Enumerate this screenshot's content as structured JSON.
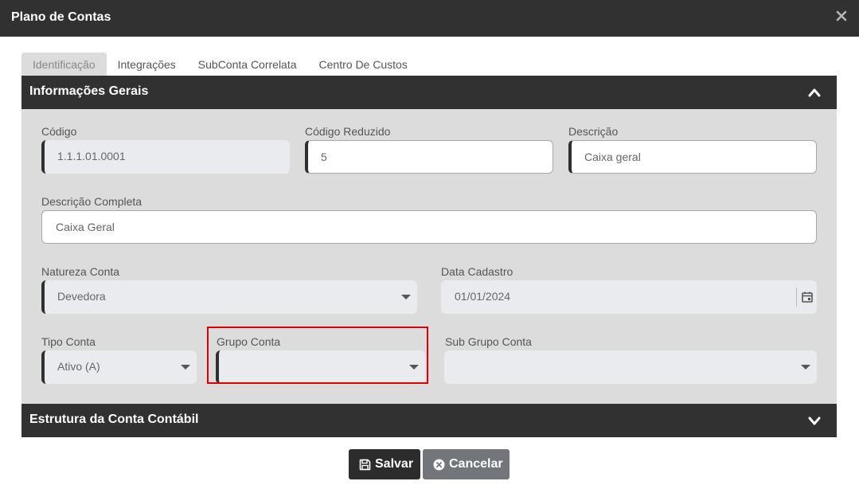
{
  "window": {
    "title": "Plano de Contas"
  },
  "tabs": [
    {
      "label": "Identificação",
      "active": true
    },
    {
      "label": "Integrações",
      "active": false
    },
    {
      "label": "SubConta Correlata",
      "active": false
    },
    {
      "label": "Centro De Custos",
      "active": false
    }
  ],
  "sections": {
    "general": {
      "title": "Informações Gerais",
      "expanded": true
    },
    "structure": {
      "title": "Estrutura da Conta Contábil",
      "expanded": false
    }
  },
  "form": {
    "codigo": {
      "label": "Código",
      "value": "1.1.1.01.0001"
    },
    "codigo_reduzido": {
      "label": "Código Reduzido",
      "value": "5"
    },
    "descricao": {
      "label": "Descrição",
      "value": "Caixa geral"
    },
    "descricao_completa": {
      "label": "Descrição Completa",
      "value": "Caixa Geral"
    },
    "natureza_conta": {
      "label": "Natureza Conta",
      "value": "Devedora"
    },
    "data_cadastro": {
      "label": "Data Cadastro",
      "value": "01/01/2024"
    },
    "tipo_conta": {
      "label": "Tipo Conta",
      "value": "Ativo (A)"
    },
    "grupo_conta": {
      "label": "Grupo Conta",
      "value": ""
    },
    "sub_grupo_conta": {
      "label": "Sub Grupo Conta",
      "value": ""
    }
  },
  "buttons": {
    "save": "Salvar",
    "cancel": "Cancelar"
  },
  "icons": {
    "close": "close-icon",
    "collapse": "chevron-up-icon",
    "expand": "chevron-down-icon",
    "calendar": "calendar-icon",
    "save": "floppy-disk-icon",
    "cancel": "x-circle-icon"
  },
  "colors": {
    "header": "#313131",
    "panel": "#dcdcdc",
    "highlight": "#e00000",
    "save_button": "#2c2c2c",
    "cancel_button": "#72767b"
  }
}
